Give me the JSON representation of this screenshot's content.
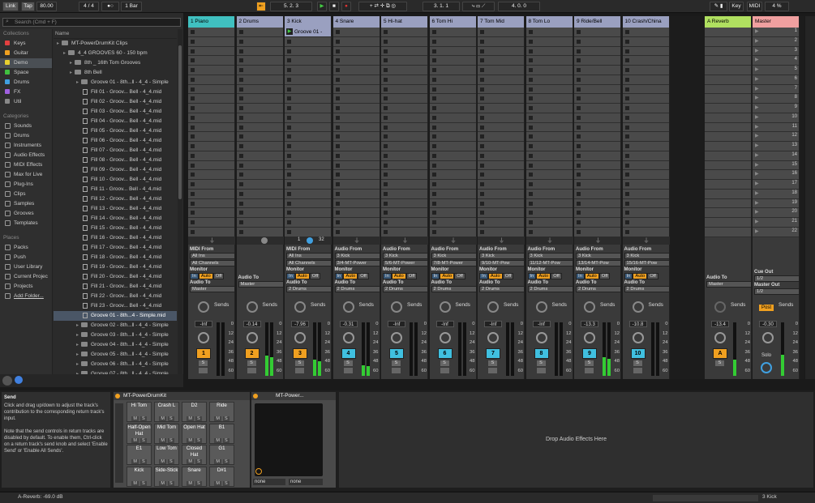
{
  "top": {
    "link": "Link",
    "tap": "Tap",
    "tempo": "80.00",
    "meter": "4 / 4",
    "quant": "1 Bar",
    "position": "5.   2.   3",
    "loop_start": "3.   1.   1",
    "loop_length": "4.   0.   0",
    "key": "Key",
    "midi": "MIDI",
    "cpu": "4 %"
  },
  "browser": {
    "search_placeholder": "Search (Cmd + F)",
    "col_name": "Name",
    "collections_title": "Collections",
    "collections": [
      {
        "label": "Keys",
        "color": "#e34040"
      },
      {
        "label": "Guitar",
        "color": "#f0a020"
      },
      {
        "label": "Demo",
        "color": "#e8d030"
      },
      {
        "label": "Space",
        "color": "#40c040"
      },
      {
        "label": "Drums",
        "color": "#40a0e0"
      },
      {
        "label": "FX",
        "color": "#a060e0"
      },
      {
        "label": "Util",
        "color": "#888888"
      }
    ],
    "categories_title": "Categories",
    "categories": [
      "Sounds",
      "Drums",
      "Instruments",
      "Audio Effects",
      "MIDI Effects",
      "Max for Live",
      "Plug-Ins",
      "Clips",
      "Samples",
      "Grooves",
      "Templates"
    ],
    "places_title": "Places",
    "places": [
      "Packs",
      "Push",
      "User Library",
      "Current Projec",
      "Projects",
      "Add Folder..."
    ],
    "tree": [
      {
        "label": "MT-PowerDrumKit Clips",
        "indent": 0,
        "type": "folder"
      },
      {
        "label": "4_4 GROOVES 60 - 150 bpm",
        "indent": 1,
        "type": "folder"
      },
      {
        "label": "8th _ 16th Tom Grooves",
        "indent": 2,
        "type": "folder"
      },
      {
        "label": "8th Bell",
        "indent": 2,
        "type": "folder"
      },
      {
        "label": "Groove 01 - 8th...ll - 4_4 - Simple",
        "indent": 3,
        "type": "folder"
      },
      {
        "label": "Fill 01 - Groov... Bell - 4_4.mid",
        "indent": 4,
        "type": "file"
      },
      {
        "label": "Fill 02 - Groov... Bell - 4_4.mid",
        "indent": 4,
        "type": "file"
      },
      {
        "label": "Fill 03 - Groov... Bell - 4_4.mid",
        "indent": 4,
        "type": "file"
      },
      {
        "label": "Fill 04 - Groov... Bell - 4_4.mid",
        "indent": 4,
        "type": "file"
      },
      {
        "label": "Fill 05 - Groov... Bell - 4_4.mid",
        "indent": 4,
        "type": "file"
      },
      {
        "label": "Fill 06 - Groov... Bell - 4_4.mid",
        "indent": 4,
        "type": "file"
      },
      {
        "label": "Fill 07 - Groov... Bell - 4_4.mid",
        "indent": 4,
        "type": "file"
      },
      {
        "label": "Fill 08 - Groov... Bell - 4_4.mid",
        "indent": 4,
        "type": "file"
      },
      {
        "label": "Fill 09 - Groov... Bell - 4_4.mid",
        "indent": 4,
        "type": "file"
      },
      {
        "label": "Fill 10 - Groov... Bell - 4_4.mid",
        "indent": 4,
        "type": "file"
      },
      {
        "label": "Fill 11 - Groov... Bell - 4_4.mid",
        "indent": 4,
        "type": "file"
      },
      {
        "label": "Fill 12 - Groov... Bell - 4_4.mid",
        "indent": 4,
        "type": "file"
      },
      {
        "label": "Fill 13 - Groov... Bell - 4_4.mid",
        "indent": 4,
        "type": "file"
      },
      {
        "label": "Fill 14 - Groov... Bell - 4_4.mid",
        "indent": 4,
        "type": "file"
      },
      {
        "label": "Fill 15 - Groov... Bell - 4_4.mid",
        "indent": 4,
        "type": "file"
      },
      {
        "label": "Fill 16 - Groov... Bell - 4_4.mid",
        "indent": 4,
        "type": "file"
      },
      {
        "label": "Fill 17 - Groov... Bell - 4_4.mid",
        "indent": 4,
        "type": "file"
      },
      {
        "label": "Fill 18 - Groov... Bell - 4_4.mid",
        "indent": 4,
        "type": "file"
      },
      {
        "label": "Fill 19 - Groov... Bell - 4_4.mid",
        "indent": 4,
        "type": "file"
      },
      {
        "label": "Fill 20 - Groov... Bell - 4_4.mid",
        "indent": 4,
        "type": "file"
      },
      {
        "label": "Fill 21 - Groov... Bell - 4_4.mid",
        "indent": 4,
        "type": "file"
      },
      {
        "label": "Fill 22 - Groov... Bell - 4_4.mid",
        "indent": 4,
        "type": "file"
      },
      {
        "label": "Fill 23 - Groov... Bell - 4_4.mid",
        "indent": 4,
        "type": "file"
      },
      {
        "label": "Groove 01 - 8th...4 - Simple.mid",
        "indent": 4,
        "type": "file",
        "selected": true
      },
      {
        "label": "Groove 02 - 8th...ll - 4_4 - Simple",
        "indent": 3,
        "type": "folder"
      },
      {
        "label": "Groove 03 - 8th...ll - 4_4 - Simple",
        "indent": 3,
        "type": "folder"
      },
      {
        "label": "Groove 04 - 8th...ll - 4_4 - Simple",
        "indent": 3,
        "type": "folder"
      },
      {
        "label": "Groove 05 - 8th...ll - 4_4 - Simple",
        "indent": 3,
        "type": "folder"
      },
      {
        "label": "Groove 06 - 8th...ll - 4_4 - Simple",
        "indent": 3,
        "type": "folder"
      },
      {
        "label": "Groove 07 - 8th...ll - 4_4 - Simple",
        "indent": 3,
        "type": "folder"
      }
    ]
  },
  "tracks": [
    {
      "name": "1 Piano",
      "color": "#40c0c0",
      "type": "midi",
      "from": "All Ins",
      "chan": "All Channels",
      "to": "Master",
      "vol": "-Inf",
      "num": "1",
      "numcolor": "#f0a020",
      "meter": 0
    },
    {
      "name": "2 Drums",
      "color": "#9aa0c0",
      "type": "group",
      "to": "Master",
      "vol": "-0.14",
      "num": "2",
      "numcolor": "#f0a020",
      "meter": 0.38
    },
    {
      "name": "3 Kick",
      "color": "#9aa0c0",
      "type": "midi",
      "from": "All Ins",
      "chan": "All Channels",
      "to": "2 Drums",
      "vol": "-7.96",
      "num": "3",
      "numcolor": "#f0a020",
      "meter": 0.3,
      "clip": "Groove 01 - 8th"
    },
    {
      "name": "4 Snare",
      "color": "#9aa0c0",
      "type": "audio",
      "from": "3 Kick",
      "chan": "3/4-MT-Power",
      "to": "2 Drums",
      "vol": "-0.31",
      "num": "4",
      "numcolor": "#40c0e0",
      "meter": 0.2
    },
    {
      "name": "5 Hi-hat",
      "color": "#9aa0c0",
      "type": "audio",
      "from": "3 Kick",
      "chan": "5/6-MT-Power",
      "to": "2 Drums",
      "vol": "-Inf",
      "num": "5",
      "numcolor": "#40c0e0",
      "meter": 0
    },
    {
      "name": "6 Tom Hi",
      "color": "#9aa0c0",
      "type": "audio",
      "from": "3 Kick",
      "chan": "7/8-MT-Power",
      "to": "2 Drums",
      "vol": "-Inf",
      "num": "6",
      "numcolor": "#40c0e0",
      "meter": 0
    },
    {
      "name": "7 Tom Mid",
      "color": "#9aa0c0",
      "type": "audio",
      "from": "3 Kick",
      "chan": "9/10-MT-Pow",
      "to": "2 Drums",
      "vol": "-Inf",
      "num": "7",
      "numcolor": "#40c0e0",
      "meter": 0
    },
    {
      "name": "8 Tom Lo",
      "color": "#9aa0c0",
      "type": "audio",
      "from": "3 Kick",
      "chan": "11/12-MT-Pow",
      "to": "2 Drums",
      "vol": "-Inf",
      "num": "8",
      "numcolor": "#40c0e0",
      "meter": 0
    },
    {
      "name": "9 Ride/Bell",
      "color": "#9aa0c0",
      "type": "audio",
      "from": "3 Kick",
      "chan": "13/14-MT-Pow",
      "to": "2 Drums",
      "vol": "-13.3",
      "num": "9",
      "numcolor": "#40c0e0",
      "meter": 0.35
    },
    {
      "name": "10 Crash/China",
      "color": "#9aa0c0",
      "type": "audio",
      "from": "3 Kick",
      "chan": "15/16-MT-Pow",
      "to": "2 Drums",
      "vol": "-10.8",
      "num": "10",
      "numcolor": "#40c0e0",
      "meter": 0
    }
  ],
  "returns": {
    "reverb": {
      "name": "A Reverb",
      "color": "#b0e060",
      "to": "Master",
      "vol": "-13.4",
      "num": "A"
    },
    "master": {
      "name": "Master",
      "color": "#f0a0a0",
      "cue_label": "Cue Out",
      "cue": "1/2",
      "mo_label": "Master Out",
      "mo": "1/2",
      "vol": "-0.30",
      "post": "Post",
      "solo": "Solo"
    }
  },
  "labels": {
    "midi_from": "MIDI From",
    "audio_from": "Audio From",
    "monitor": "Monitor",
    "mon_in": "In",
    "mon_auto": "Auto",
    "mon_off": "Off",
    "audio_to": "Audio To",
    "sends": "Sends",
    "s": "S",
    "scale": [
      "0",
      "12",
      "24",
      "36",
      "48",
      "60"
    ],
    "group_pos": "1",
    "group_len": "32"
  },
  "scene_numbers": [
    "1",
    "2",
    "3",
    "4",
    "5",
    "6",
    "7",
    "8",
    "9",
    "10",
    "11",
    "12",
    "13",
    "14",
    "15",
    "16",
    "17",
    "18",
    "19",
    "20",
    "21",
    "22"
  ],
  "info": {
    "title": "Send",
    "p1": "Click and drag up/down to adjust the track's contribution to the corresponding return track's input.",
    "p2": "Note that the send controls in return tracks are disabled by default. To enable them, Ctrl-click on a return track's send knob and select 'Enable Send' or 'Enable All Sends'."
  },
  "drumrack": {
    "title": "MT-PowerDrumKit",
    "pads": [
      {
        "label": "Hi Tom",
        "col": 0,
        "row": 0
      },
      {
        "label": "Crash L",
        "col": 1,
        "row": 0
      },
      {
        "label": "D2",
        "col": 2,
        "row": 0
      },
      {
        "label": "Ride",
        "col": 3,
        "row": 0
      },
      {
        "label": "Half-Open Hat",
        "col": 0,
        "row": 1
      },
      {
        "label": "Mid Tom",
        "col": 1,
        "row": 1
      },
      {
        "label": "Open Hat",
        "col": 2,
        "row": 1
      },
      {
        "label": "B1",
        "col": 3,
        "row": 1
      },
      {
        "label": "E1",
        "col": 0,
        "row": 2
      },
      {
        "label": "Low Tom",
        "col": 1,
        "row": 2
      },
      {
        "label": "Closed Hat",
        "col": 2,
        "row": 2
      },
      {
        "label": "G1",
        "col": 3,
        "row": 2
      },
      {
        "label": "Kick",
        "col": 0,
        "row": 3
      },
      {
        "label": "Side-Stick",
        "col": 1,
        "row": 3
      },
      {
        "label": "Snare",
        "col": 2,
        "row": 3
      },
      {
        "label": "D#1",
        "col": 3,
        "row": 3
      }
    ],
    "m": "M",
    "s": "S"
  },
  "simpler": {
    "title": "MT-Power...",
    "none1": "none",
    "none2": "none"
  },
  "drop_text": "Drop Audio Effects Here",
  "status": {
    "left": "A-Reverb: -69.0 dB",
    "right": "3 Kick"
  },
  "colors": {
    "accent": "#f0a020",
    "meter": "#33cc33"
  }
}
